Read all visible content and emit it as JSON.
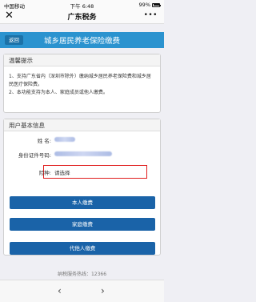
{
  "status_bar": {
    "signal": "中国移动",
    "time": "下午 6:48",
    "battery": "99%"
  },
  "nav": {
    "close_icon": "✕",
    "title": "广东税务",
    "more_icon": "•••"
  },
  "header": {
    "back_label": "返回",
    "title": "城乡居民养老保险缴费"
  },
  "tips_card": {
    "title": "温馨提示",
    "line1": "1、支持广东省内（深圳市除外）缴纳城乡居民养老保险费和城乡居民医疗保险费。",
    "line2": "2、本功能支持为本人、家庭成员或他人缴费。"
  },
  "info_card": {
    "title": "用户基本信息",
    "name_label": "姓 名:",
    "name_value": "",
    "id_label": "身份证件号码:",
    "id_value": "",
    "insurance_label": "险种:",
    "insurance_value": "请选择"
  },
  "buttons": {
    "self_pay": "本人缴费",
    "family_pay": "家庭缴费",
    "other_pay": "代他人缴费"
  },
  "footer": {
    "hotline": "纳税服务热线：12366"
  },
  "bottom_nav": {
    "prev_icon": "‹",
    "next_icon": "›"
  },
  "colors": {
    "header_blue": "#2b93cf",
    "button_blue": "#1a63a8",
    "highlight_red": "#e01c1c"
  }
}
